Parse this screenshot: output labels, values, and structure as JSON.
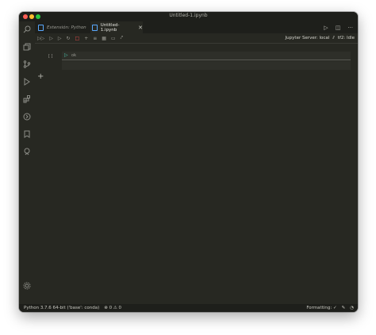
{
  "window": {
    "title": "Untitled-1.ipynb"
  },
  "tabs": [
    {
      "label": "Extensión: Python"
    },
    {
      "label": "Untitled-1.ipynb"
    }
  ],
  "toolbar": {
    "server_label": "Jupyter Server: local",
    "kernel_label": "tf2: Idle"
  },
  "cell": {
    "exec_count": "[ ]",
    "source": "ok"
  },
  "status": {
    "interpreter": "Python 3.7.6 64-bit ('base': conda)",
    "problems": "0",
    "warnings": "0",
    "formatting": "Formatting: ✓"
  }
}
